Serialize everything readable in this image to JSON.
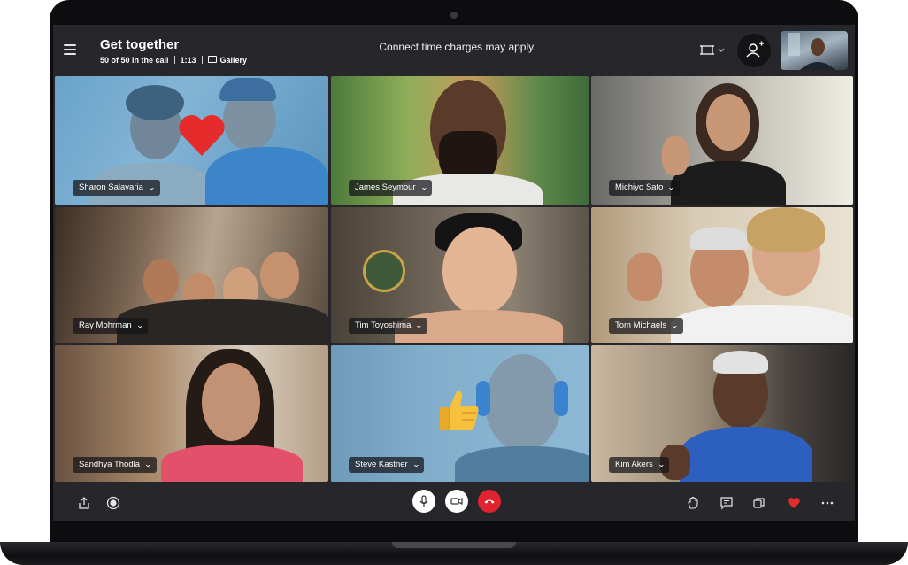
{
  "call": {
    "title": "Get together",
    "participants": "50 of 50 in the call",
    "duration": "1:13",
    "view_mode": "Gallery",
    "notice": "Connect time charges may apply."
  },
  "participants": [
    {
      "name": "Sharon Salavaria",
      "reaction": "heart-icon"
    },
    {
      "name": "James Seymour"
    },
    {
      "name": "Michiyo Sato"
    },
    {
      "name": "Ray Mohrman"
    },
    {
      "name": "Tim Toyoshima"
    },
    {
      "name": "Tom Michaels"
    },
    {
      "name": "Sandhya Thodla"
    },
    {
      "name": "Steve Kastner",
      "reaction": "thumbs-up-icon"
    },
    {
      "name": "Kim Akers"
    }
  ],
  "colors": {
    "app_bg": "#26262b",
    "end_call": "#e0232f",
    "heart": "#e52b2b",
    "reaction_tint": "#4a98ce"
  },
  "toolbar": {
    "left": [
      "share-icon",
      "record-icon"
    ],
    "center": [
      "microphone-icon",
      "video-camera-icon",
      "end-call-icon"
    ],
    "right": [
      "raise-hand-icon",
      "chat-icon",
      "switch-view-icon",
      "heart-icon",
      "more-options-icon"
    ]
  }
}
